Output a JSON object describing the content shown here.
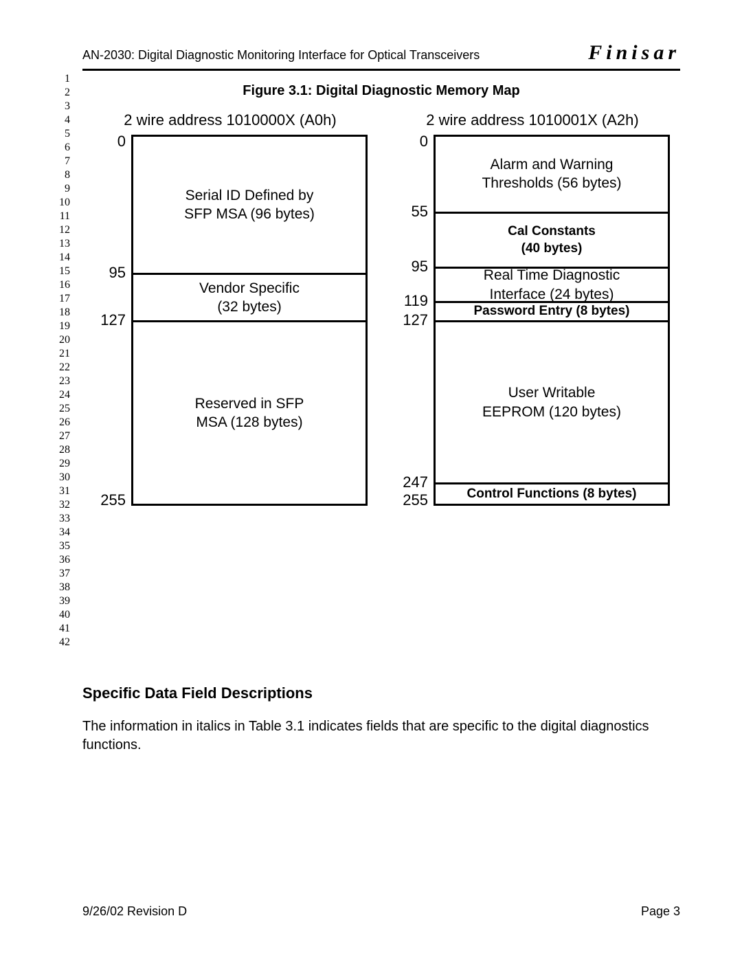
{
  "header": {
    "title": "AN-2030: Digital Diagnostic Monitoring Interface for Optical Transceivers",
    "brand": "Finisar"
  },
  "line_numbers": {
    "start": 1,
    "end": 42
  },
  "figure": {
    "caption": "Figure 3.1: Digital Diagnostic Memory Map",
    "left": {
      "title": "2 wire address 1010000X (A0h)",
      "addresses": [
        "0",
        "95",
        "127",
        "255"
      ],
      "segments": [
        {
          "label": "Serial ID Defined by\nSFP MSA (96 bytes)",
          "weight": 96,
          "bold": false
        },
        {
          "label": "Vendor Specific\n(32 bytes)",
          "weight": 32,
          "bold": false
        },
        {
          "label": "Reserved in SFP\nMSA (128 bytes)",
          "weight": 128,
          "bold": false
        }
      ]
    },
    "right": {
      "title": "2 wire address 1010001X (A2h)",
      "addresses": [
        "0",
        "55",
        "95",
        "119",
        "127",
        "247",
        "255"
      ],
      "segments": [
        {
          "label": "Alarm and Warning\nThresholds (56 bytes)",
          "weight": 56,
          "bold": false
        },
        {
          "label": "Cal Constants\n(40 bytes)",
          "weight": 40,
          "bold": true
        },
        {
          "label": "Real Time Diagnostic\nInterface (24 bytes)",
          "weight": 24,
          "bold": false
        },
        {
          "label": "Password Entry (8 bytes)",
          "weight": 8,
          "bold": true
        },
        {
          "label": "User Writable\nEEPROM (120 bytes)",
          "weight": 120,
          "bold": false
        },
        {
          "label": "Control Functions (8 bytes)",
          "weight": 8,
          "bold": true
        }
      ]
    }
  },
  "section": {
    "heading": "Specific Data Field Descriptions",
    "body": "The information in italics in Table 3.1 indicates fields that are specific to the digital diagnostics functions."
  },
  "footer": {
    "left": "9/26/02 Revision D",
    "right": "Page 3"
  }
}
